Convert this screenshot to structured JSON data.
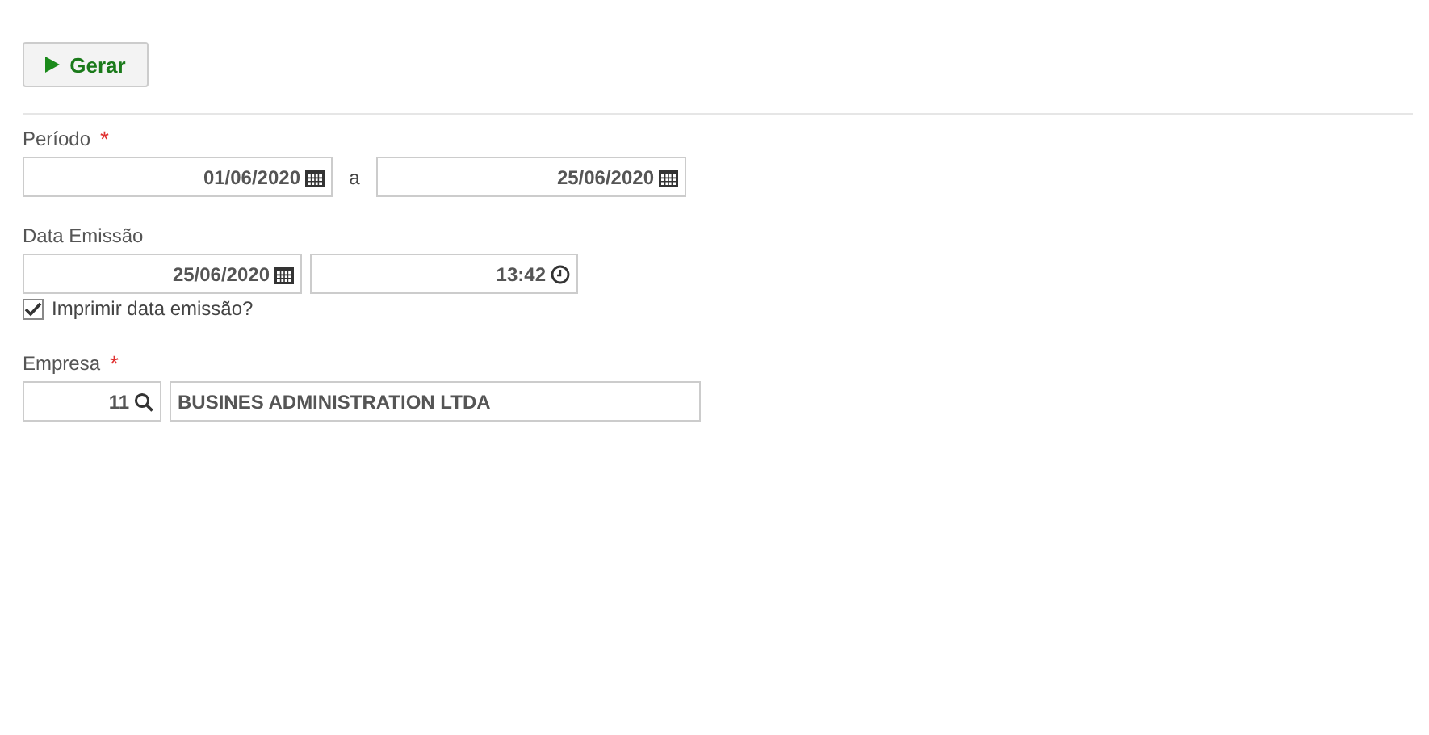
{
  "toolbar": {
    "generate_button": {
      "label": "Gerar"
    }
  },
  "periodo": {
    "label": "Período",
    "required_mark": "*",
    "start": "01/06/2020",
    "separator": "a",
    "end": "25/06/2020"
  },
  "data_emissao": {
    "label": "Data Emissão",
    "date": "25/06/2020",
    "time": "13:42",
    "print_checkbox": {
      "label": "Imprimir data emissão?",
      "checked": true
    }
  },
  "empresa": {
    "label": "Empresa",
    "required_mark": "*",
    "code": "11",
    "name": "BUSINES ADMINISTRATION LTDA"
  }
}
